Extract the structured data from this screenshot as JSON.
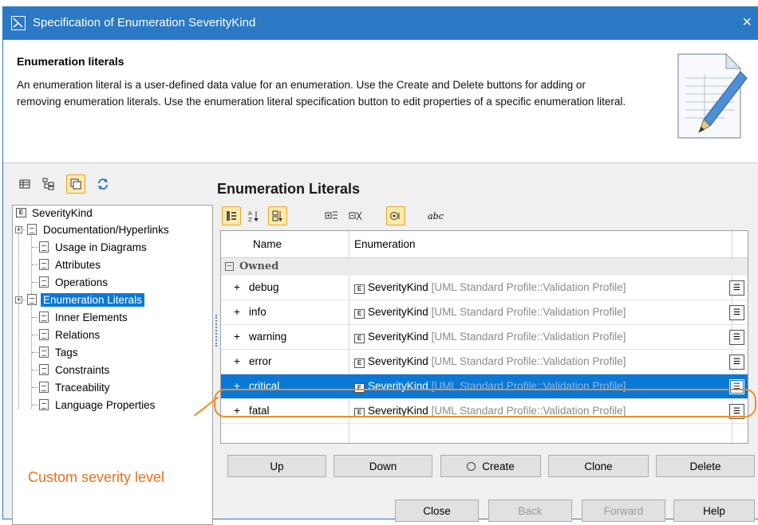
{
  "window": {
    "title": "Specification of Enumeration SeverityKind",
    "close_glyph": "×"
  },
  "header": {
    "heading": "Enumeration literals",
    "description": "An enumeration literal is a user-defined data value for an enumeration. Use the Create and Delete buttons for adding or removing enumeration literals. Use the enumeration literal specification button to edit properties of a specific enumeration literal."
  },
  "tree_toolbar": {
    "icons": [
      "list-view-icon",
      "tree-view-icon",
      "compact-view-icon",
      "refresh-icon"
    ]
  },
  "tree": {
    "root": "SeverityKind",
    "items": [
      {
        "label": "Documentation/Hyperlinks",
        "expandable": true
      },
      {
        "label": "Usage in Diagrams",
        "expandable": false
      },
      {
        "label": "Attributes",
        "expandable": false
      },
      {
        "label": "Operations",
        "expandable": false
      },
      {
        "label": "Enumeration Literals",
        "expandable": true,
        "selected": true
      },
      {
        "label": "Inner Elements",
        "expandable": false
      },
      {
        "label": "Relations",
        "expandable": false
      },
      {
        "label": "Tags",
        "expandable": false
      },
      {
        "label": "Constraints",
        "expandable": false
      },
      {
        "label": "Traceability",
        "expandable": false
      },
      {
        "label": "Language Properties",
        "expandable": false
      }
    ]
  },
  "annotation": {
    "text": "Custom severity level",
    "color": "#e9711c"
  },
  "panel": {
    "title": "Enumeration Literals",
    "abc_label": "abc"
  },
  "table": {
    "columns": [
      "Name",
      "Enumeration"
    ],
    "group": "Owned",
    "enum_name": "SeverityKind",
    "enum_qualifier": "[UML Standard Profile::Validation Profile]",
    "rows": [
      {
        "name": "debug",
        "selected": false
      },
      {
        "name": "info",
        "selected": false
      },
      {
        "name": "warning",
        "selected": false
      },
      {
        "name": "error",
        "selected": false
      },
      {
        "name": "critical",
        "selected": true
      },
      {
        "name": "fatal",
        "selected": false
      }
    ]
  },
  "table_buttons": {
    "up": "Up",
    "down": "Down",
    "create": "Create",
    "clone": "Clone",
    "delete": "Delete"
  },
  "dialog_buttons": {
    "close": "Close",
    "back": "Back",
    "forward": "Forward",
    "help": "Help"
  },
  "colors": {
    "titlebar": "#2b78c4",
    "selection": "#0a78d7",
    "highlight": "#f08b2a"
  }
}
